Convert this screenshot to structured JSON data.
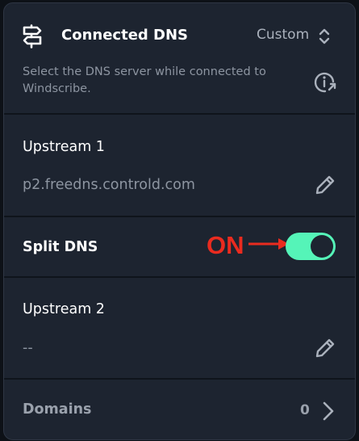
{
  "header": {
    "title": "Connected DNS",
    "mode": "Custom",
    "description": "Select the DNS server while connected to Windscribe."
  },
  "upstream1": {
    "label": "Upstream 1",
    "value": "p2.freedns.controld.com"
  },
  "split_dns": {
    "label": "Split DNS",
    "enabled": true,
    "annotation": "ON"
  },
  "upstream2": {
    "label": "Upstream 2",
    "value": "--"
  },
  "domains": {
    "label": "Domains",
    "count": "0"
  },
  "colors": {
    "panel_bg": "#1d2430",
    "toggle_on": "#55f4b8",
    "annotation_red": "#ea2b1f",
    "muted_text": "#8d95a1"
  },
  "icons": {
    "header": "signpost-icon",
    "mode_selector": "up-down-chevron-icon",
    "info": "info-external-icon",
    "edit": "pencil-icon",
    "domains": "chevron-right-icon"
  }
}
